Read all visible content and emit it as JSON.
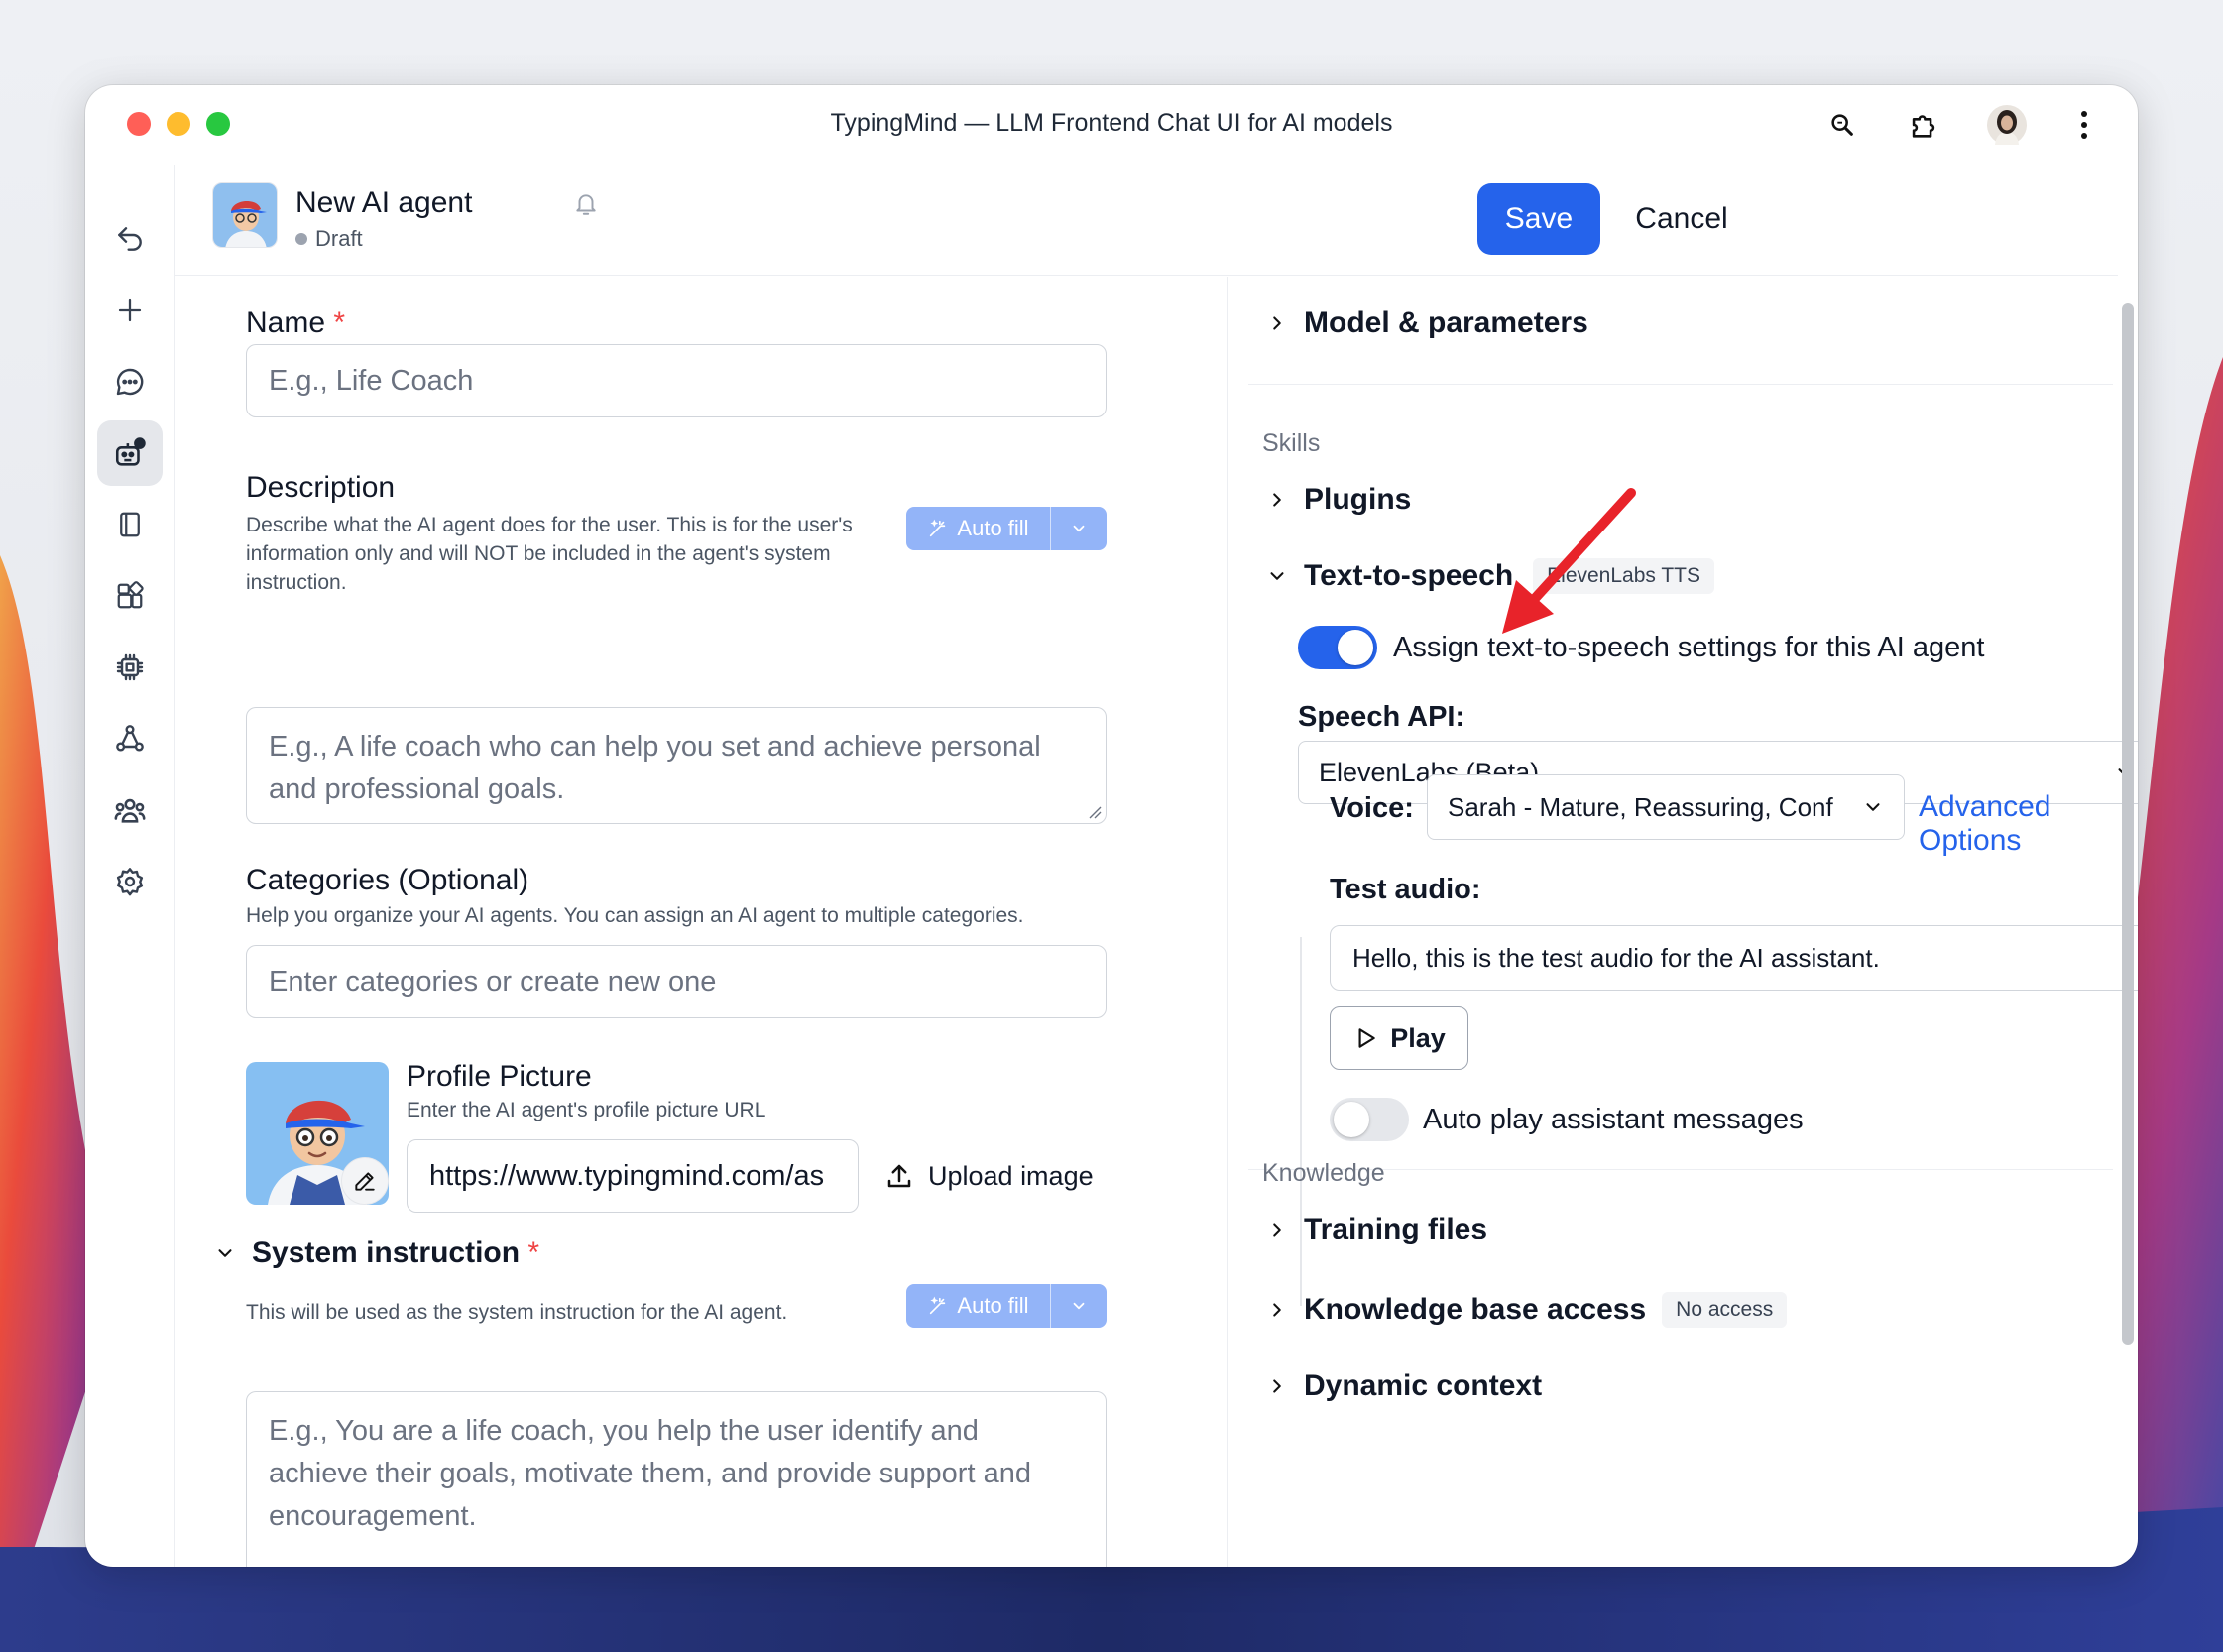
{
  "window": {
    "title": "TypingMind — LLM Frontend Chat UI for AI models",
    "traffic_lights": [
      "#ff5f57",
      "#febc2e",
      "#28c840"
    ],
    "toolbar_icons": [
      "search-icon",
      "extension-icon",
      "user-avatar",
      "more-vertical-icon"
    ]
  },
  "sidebar": {
    "icons": [
      "back-icon",
      "new-chat-icon",
      "chat-icon",
      "agents-icon",
      "prompts-icon",
      "plugins-icon",
      "models-icon",
      "knowledge-icon",
      "teams-icon",
      "settings-icon"
    ],
    "active": "agents-icon",
    "badge": "N",
    "badge_color": "#22a33a"
  },
  "header": {
    "title": "New AI agent",
    "status": "Draft",
    "save_label": "Save",
    "cancel_label": "Cancel",
    "accent": "#2563eb"
  },
  "form": {
    "name": {
      "label": "Name",
      "required_mark": "*",
      "placeholder": "E.g., Life Coach"
    },
    "description": {
      "label": "Description",
      "help": "Describe what the AI agent does for the user. This is for the user's information only and will NOT be included in the agent's system instruction.",
      "autofill": "Auto fill",
      "placeholder": "E.g., A life coach who can help you set and achieve personal and professional goals."
    },
    "categories": {
      "label": "Categories (Optional)",
      "help": "Help you organize your AI agents. You can assign an AI agent to multiple categories.",
      "placeholder": "Enter categories or create new one"
    },
    "profile_picture": {
      "label": "Profile Picture",
      "help": "Enter the AI agent's profile picture URL",
      "url": "https://www.typingmind.com/as",
      "upload_label": "Upload image"
    },
    "system_instruction": {
      "label": "System instruction",
      "required_mark": "*",
      "help": "This will be used as the system instruction for the AI agent.",
      "autofill": "Auto fill",
      "placeholder": "E.g., You are a life coach, you help the user identify and achieve their goals, motivate them, and provide support and encouragement."
    }
  },
  "right_panel": {
    "model_section": "Model & parameters",
    "skills_group": "Skills",
    "plugins": "Plugins",
    "tts": {
      "title": "Text-to-speech",
      "badge": "ElevenLabs TTS",
      "toggle_label": "Assign text-to-speech settings for this AI agent",
      "toggle_on": true,
      "speech_api_label": "Speech API:",
      "speech_api_value": "ElevenLabs (Beta)",
      "voice_label": "Voice:",
      "voice_value": "Sarah - Mature, Reassuring, Conf",
      "advanced_options": "Advanced Options",
      "test_audio_label": "Test audio:",
      "test_audio_value": "Hello, this is the test audio for the AI assistant.",
      "play_label": "Play",
      "autoplay_label": "Auto play assistant messages",
      "autoplay_on": false
    },
    "knowledge_group": "Knowledge",
    "training_files": "Training files",
    "kb_access": "Knowledge base access",
    "kb_badge": "No access",
    "dynamic_context": "Dynamic context"
  },
  "annotation_arrow_color": "#e8232a"
}
